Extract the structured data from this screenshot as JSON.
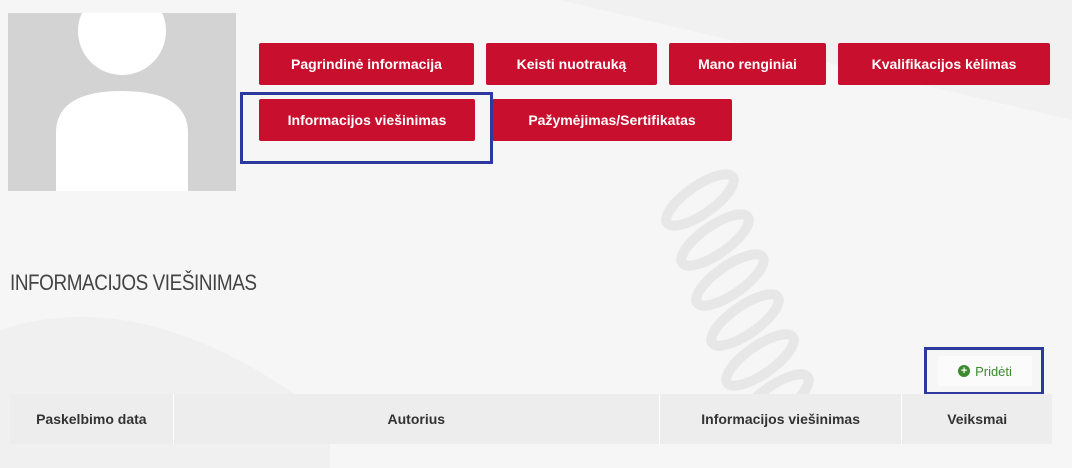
{
  "nav": {
    "buttons": [
      "Pagrindinė informacija",
      "Keisti nuotrauką",
      "Mano renginiai",
      "Kvalifikacijos kėlimas",
      "Informacijos viešinimas",
      "Pažymėjimas/Sertifikatas"
    ],
    "active": "Informacijos viešinimas"
  },
  "section": {
    "title": "INFORMACIJOS VIEŠINIMAS"
  },
  "add_button": {
    "label": "Pridėti",
    "icon": "plus-circle-icon"
  },
  "table": {
    "columns": [
      "Paskelbimo data",
      "Autorius",
      "Informacijos viešinimas",
      "Veiksmai"
    ],
    "rows": []
  },
  "colors": {
    "brand_red": "#c8102e",
    "highlight_blue": "#2c3a9e",
    "add_green": "#3c8a2e"
  }
}
